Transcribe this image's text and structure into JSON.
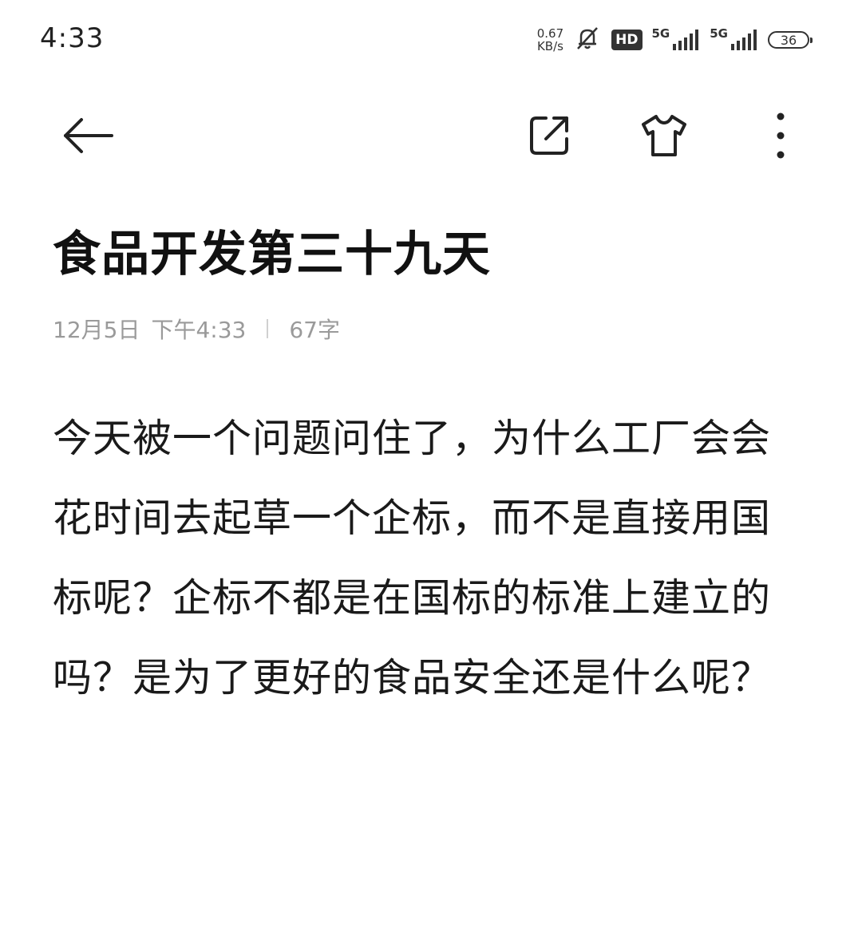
{
  "status_bar": {
    "time": "4:33",
    "net_speed_value": "0.67",
    "net_speed_unit": "KB/s",
    "hd_label": "HD",
    "signal1_label": "5G",
    "signal2_label": "5G",
    "battery_level": "36"
  },
  "icons": {
    "back": "back-arrow-icon",
    "share": "share-icon",
    "theme": "tshirt-icon",
    "more": "more-vertical-icon"
  },
  "note": {
    "title": "食品开发第三十九天",
    "date": "12月5日",
    "time": "下午4:33",
    "word_count": "67字",
    "body": "今天被一个问题问住了，为什么工厂会会花时间去起草一个企标，而不是直接用国标呢？企标不都是在国标的标准上建立的吗？是为了更好的食品安全还是什么呢？"
  }
}
